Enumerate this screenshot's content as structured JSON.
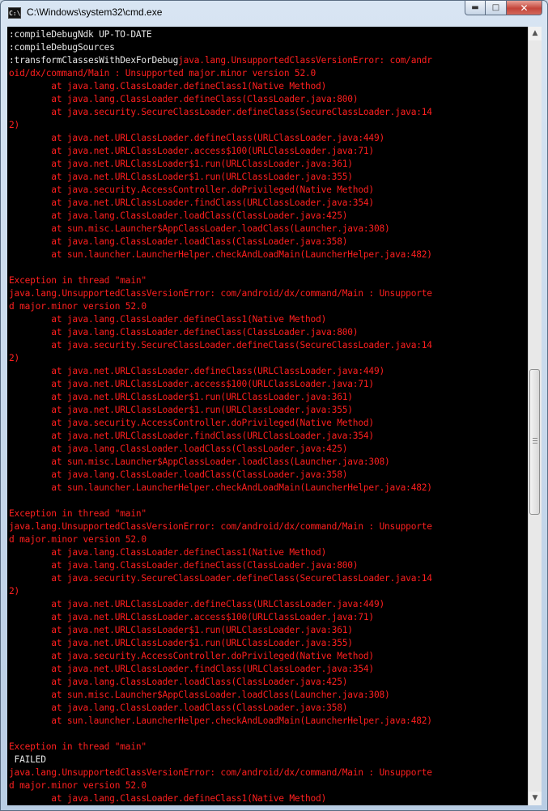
{
  "window": {
    "title": "C:\\Windows\\system32\\cmd.exe",
    "icon": "cmd-icon",
    "buttons": {
      "minimize": "minimize-icon",
      "maximize": "maximize-icon",
      "close": "close-icon"
    }
  },
  "colors": {
    "background": "#000000",
    "normal_text": "#e6e6e6",
    "error_text": "#ff1f1f"
  },
  "console": {
    "lines": [
      {
        "text": ":compileDebugNdk UP-TO-DATE",
        "color": "white"
      },
      {
        "text": ":compileDebugSources",
        "color": "white"
      },
      {
        "segments": [
          {
            "text": ":transformClassesWithDexForDebug",
            "color": "white"
          },
          {
            "text": "java.lang.UnsupportedClassVersionError: com/andr",
            "color": "red"
          }
        ]
      },
      {
        "text": "oid/dx/command/Main : Unsupported major.minor version 52.0",
        "color": "red"
      },
      {
        "text": "        at java.lang.ClassLoader.defineClass1(Native Method)",
        "color": "red"
      },
      {
        "text": "        at java.lang.ClassLoader.defineClass(ClassLoader.java:800)",
        "color": "red"
      },
      {
        "text": "        at java.security.SecureClassLoader.defineClass(SecureClassLoader.java:14",
        "color": "red"
      },
      {
        "text": "2)",
        "color": "red"
      },
      {
        "text": "        at java.net.URLClassLoader.defineClass(URLClassLoader.java:449)",
        "color": "red"
      },
      {
        "text": "        at java.net.URLClassLoader.access$100(URLClassLoader.java:71)",
        "color": "red"
      },
      {
        "text": "        at java.net.URLClassLoader$1.run(URLClassLoader.java:361)",
        "color": "red"
      },
      {
        "text": "        at java.net.URLClassLoader$1.run(URLClassLoader.java:355)",
        "color": "red"
      },
      {
        "text": "        at java.security.AccessController.doPrivileged(Native Method)",
        "color": "red"
      },
      {
        "text": "        at java.net.URLClassLoader.findClass(URLClassLoader.java:354)",
        "color": "red"
      },
      {
        "text": "        at java.lang.ClassLoader.loadClass(ClassLoader.java:425)",
        "color": "red"
      },
      {
        "text": "        at sun.misc.Launcher$AppClassLoader.loadClass(Launcher.java:308)",
        "color": "red"
      },
      {
        "text": "        at java.lang.ClassLoader.loadClass(ClassLoader.java:358)",
        "color": "red"
      },
      {
        "text": "        at sun.launcher.LauncherHelper.checkAndLoadMain(LauncherHelper.java:482)",
        "color": "red"
      },
      {
        "text": "",
        "color": "red"
      },
      {
        "text": "Exception in thread \"main\"",
        "color": "red"
      },
      {
        "text": "java.lang.UnsupportedClassVersionError: com/android/dx/command/Main : Unsupporte",
        "color": "red"
      },
      {
        "text": "d major.minor version 52.0",
        "color": "red"
      },
      {
        "text": "        at java.lang.ClassLoader.defineClass1(Native Method)",
        "color": "red"
      },
      {
        "text": "        at java.lang.ClassLoader.defineClass(ClassLoader.java:800)",
        "color": "red"
      },
      {
        "text": "        at java.security.SecureClassLoader.defineClass(SecureClassLoader.java:14",
        "color": "red"
      },
      {
        "text": "2)",
        "color": "red"
      },
      {
        "text": "        at java.net.URLClassLoader.defineClass(URLClassLoader.java:449)",
        "color": "red"
      },
      {
        "text": "        at java.net.URLClassLoader.access$100(URLClassLoader.java:71)",
        "color": "red"
      },
      {
        "text": "        at java.net.URLClassLoader$1.run(URLClassLoader.java:361)",
        "color": "red"
      },
      {
        "text": "        at java.net.URLClassLoader$1.run(URLClassLoader.java:355)",
        "color": "red"
      },
      {
        "text": "        at java.security.AccessController.doPrivileged(Native Method)",
        "color": "red"
      },
      {
        "text": "        at java.net.URLClassLoader.findClass(URLClassLoader.java:354)",
        "color": "red"
      },
      {
        "text": "        at java.lang.ClassLoader.loadClass(ClassLoader.java:425)",
        "color": "red"
      },
      {
        "text": "        at sun.misc.Launcher$AppClassLoader.loadClass(Launcher.java:308)",
        "color": "red"
      },
      {
        "text": "        at java.lang.ClassLoader.loadClass(ClassLoader.java:358)",
        "color": "red"
      },
      {
        "text": "        at sun.launcher.LauncherHelper.checkAndLoadMain(LauncherHelper.java:482)",
        "color": "red"
      },
      {
        "text": "",
        "color": "red"
      },
      {
        "text": "Exception in thread \"main\"",
        "color": "red"
      },
      {
        "text": "java.lang.UnsupportedClassVersionError: com/android/dx/command/Main : Unsupporte",
        "color": "red"
      },
      {
        "text": "d major.minor version 52.0",
        "color": "red"
      },
      {
        "text": "        at java.lang.ClassLoader.defineClass1(Native Method)",
        "color": "red"
      },
      {
        "text": "        at java.lang.ClassLoader.defineClass(ClassLoader.java:800)",
        "color": "red"
      },
      {
        "text": "        at java.security.SecureClassLoader.defineClass(SecureClassLoader.java:14",
        "color": "red"
      },
      {
        "text": "2)",
        "color": "red"
      },
      {
        "text": "        at java.net.URLClassLoader.defineClass(URLClassLoader.java:449)",
        "color": "red"
      },
      {
        "text": "        at java.net.URLClassLoader.access$100(URLClassLoader.java:71)",
        "color": "red"
      },
      {
        "text": "        at java.net.URLClassLoader$1.run(URLClassLoader.java:361)",
        "color": "red"
      },
      {
        "text": "        at java.net.URLClassLoader$1.run(URLClassLoader.java:355)",
        "color": "red"
      },
      {
        "text": "        at java.security.AccessController.doPrivileged(Native Method)",
        "color": "red"
      },
      {
        "text": "        at java.net.URLClassLoader.findClass(URLClassLoader.java:354)",
        "color": "red"
      },
      {
        "text": "        at java.lang.ClassLoader.loadClass(ClassLoader.java:425)",
        "color": "red"
      },
      {
        "text": "        at sun.misc.Launcher$AppClassLoader.loadClass(Launcher.java:308)",
        "color": "red"
      },
      {
        "text": "        at java.lang.ClassLoader.loadClass(ClassLoader.java:358)",
        "color": "red"
      },
      {
        "text": "        at sun.launcher.LauncherHelper.checkAndLoadMain(LauncherHelper.java:482)",
        "color": "red"
      },
      {
        "text": "",
        "color": "red"
      },
      {
        "text": "Exception in thread \"main\"",
        "color": "red"
      },
      {
        "text": " FAILED",
        "color": "white"
      },
      {
        "text": "java.lang.UnsupportedClassVersionError: com/android/dx/command/Main : Unsupporte",
        "color": "red"
      },
      {
        "text": "d major.minor version 52.0",
        "color": "red"
      },
      {
        "text": "        at java.lang.ClassLoader.defineClass1(Native Method)",
        "color": "red"
      }
    ]
  },
  "scrollbar": {
    "up_icon": "scroll-up-arrow-icon",
    "down_icon": "scroll-down-arrow-icon",
    "position_fraction": 0.47
  }
}
